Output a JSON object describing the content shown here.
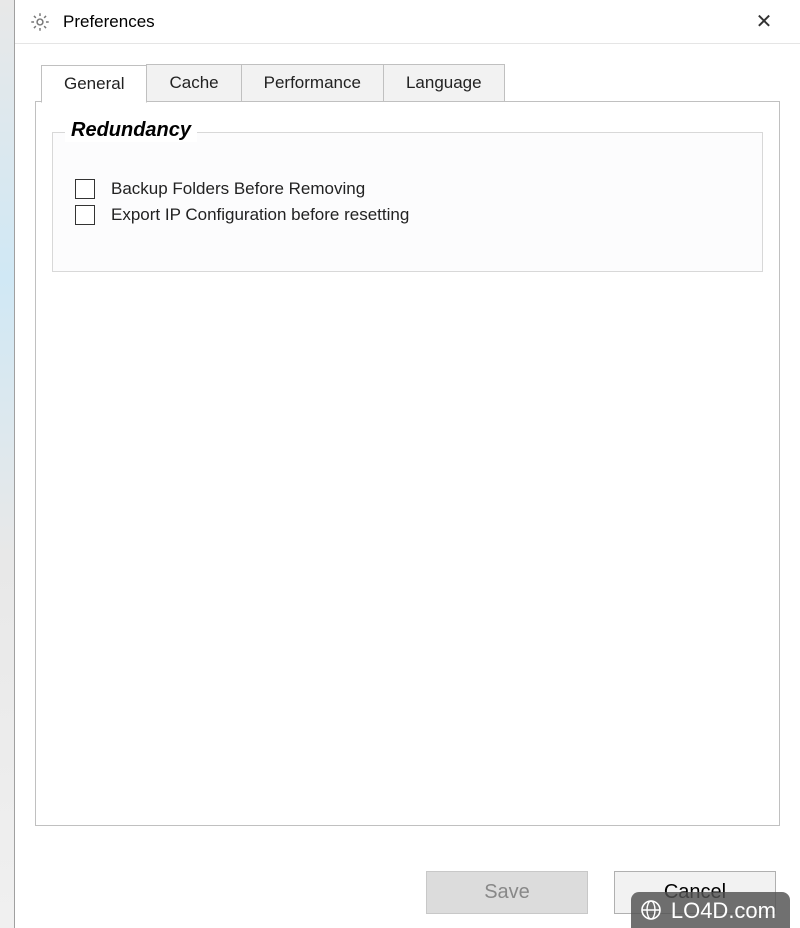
{
  "window": {
    "title": "Preferences"
  },
  "tabs": [
    {
      "label": "General",
      "active": true
    },
    {
      "label": "Cache",
      "active": false
    },
    {
      "label": "Performance",
      "active": false
    },
    {
      "label": "Language",
      "active": false
    }
  ],
  "general": {
    "group_title": "Redundancy",
    "checkboxes": [
      {
        "label": "Backup Folders Before Removing",
        "checked": false
      },
      {
        "label": "Export IP Configuration before resetting",
        "checked": false
      }
    ]
  },
  "buttons": {
    "save": "Save",
    "cancel": "Cancel"
  },
  "watermark": "LO4D.com"
}
